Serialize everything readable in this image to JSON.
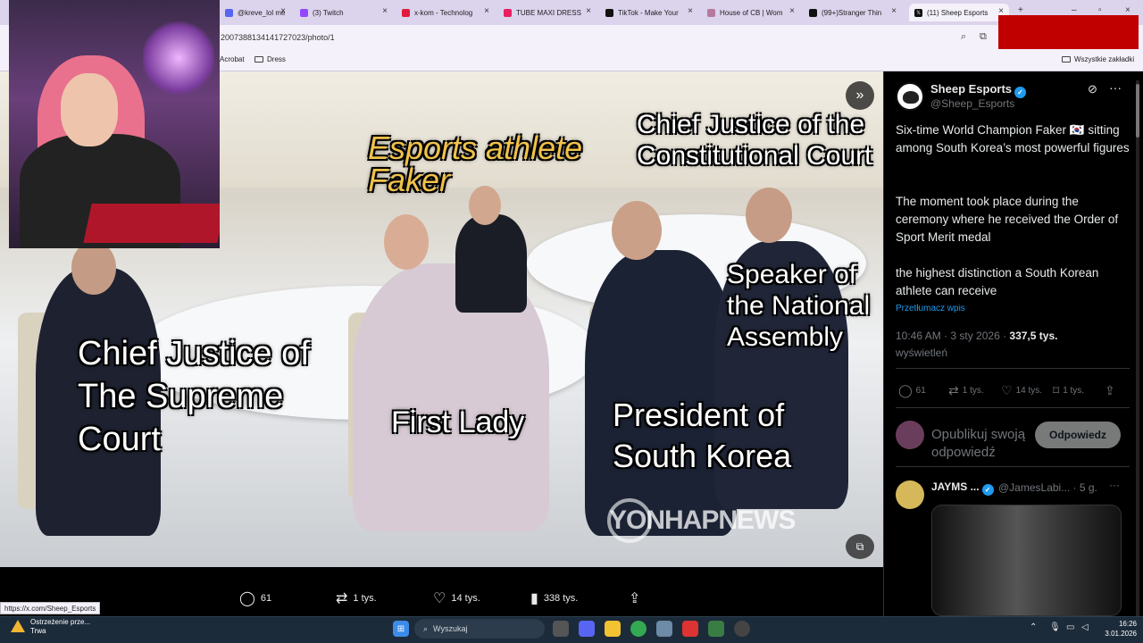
{
  "browser": {
    "tabs": [
      {
        "label": "@kreve_lol me",
        "fav_color": "#5865f2"
      },
      {
        "label": "(3) Twitch",
        "fav_color": "#9146ff"
      },
      {
        "label": "x-kom - Technolog",
        "fav_color": "#e21c3f"
      },
      {
        "label": "TUBE MAXI DRESS",
        "fav_color": "#e91e63"
      },
      {
        "label": "TikTok - Make Your",
        "fav_color": "#111111"
      },
      {
        "label": "House of CB | Wom",
        "fav_color": "#b57aa0"
      },
      {
        "label": "(99+)Stranger Thin",
        "fav_color": "#111111"
      },
      {
        "label": "(11) Sheep Esports",
        "fav_color": "#111111"
      }
    ],
    "url": "2007388134141727023/photo/1",
    "bookmarks": [
      "Acrobat",
      "Dress"
    ],
    "bookmarks_all": "Wszystkie zakładki",
    "status_url": "https://x.com/Sheep_Esports"
  },
  "photo": {
    "captions": {
      "faker": "Esports athlete Faker",
      "constitutional": "Chief Justice of the Constitutional Court",
      "speaker": "Speaker of the National Assembly",
      "supreme": "Chief Justice of The Supreme Court",
      "first_lady": "First Lady",
      "president": "President of South Korea"
    },
    "watermark": "YONHAPNEWS",
    "actions": {
      "replies": "61",
      "reposts": "1 tys.",
      "likes": "14 tys.",
      "views": "338 tys."
    }
  },
  "post": {
    "author": "Sheep Esports",
    "handle": "@Sheep_Esports",
    "paragraphs": [
      "Six-time World Champion Faker 🇰🇷 sitting among South Korea’s most powerful figures",
      "The moment took place during the ceremony where he received the Order of Sport Merit medal",
      "the highest distinction a South Korean athlete can receive"
    ],
    "translate": "Przetłumacz wpis",
    "time": "10:46 AM · 3 sty 2026 · ",
    "views_count": "337,5 tys.",
    "views_label": "wyświetleń",
    "stats": {
      "replies": "61",
      "reposts": "1 tys.",
      "likes": "14 tys.",
      "bookmarks": "1 tys."
    },
    "reply_placeholder": "Opublikuj swoją odpowiedź",
    "reply_button": "Odpowiedz",
    "comment": {
      "name": "JAYMS ...",
      "handle": "@JamesLabi... · 5 g."
    }
  },
  "taskbar": {
    "notification_title": "Ostrzeżenie prze...",
    "notification_sub": "Trwa",
    "search_placeholder": "Wyszukaj",
    "time": "16:26",
    "date": "3.01.2026"
  }
}
